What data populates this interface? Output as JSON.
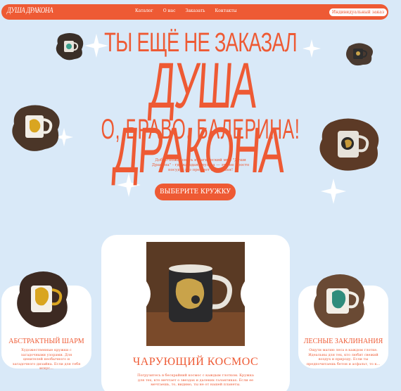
{
  "nav": {
    "logo": "ДУША ДРАКОНА",
    "links": [
      "Каталог",
      "О нас",
      "Заказать",
      "Контакты"
    ],
    "cta": "Индивидуальный заказ"
  },
  "hero": {
    "line1": "ТЫ ЕЩЁ НЕ ЗАКАЗАЛ",
    "line2": "ДУША ДРАКОНА",
    "line3": "О, БРАВО, БАЛЕРИНА!",
    "description": "Добро пожаловать в магический мир \"Души Дракона\" - где каждая кружка — это не просто посуда, это предмет обожания!",
    "button": "ВЫБЕРИТЕ КРУЖКУ"
  },
  "cards": [
    {
      "title": "АБСТРАКТНЫЙ ШАРМ",
      "text": "Художественные кружки с загадочными узорами. Для ценителей необычного и загадочного дизайна. Если для тебя искус..."
    },
    {
      "title": "ЧАРУЮЩИЙ КОСМОС",
      "text": "Погрузитесь в бескрайний космос с каждым глотком. Кружка для тех, кто мечтает о звездах и далеких галактиках. Если ее мечтаешь, то, видимо, ты не от нашей планеты."
    },
    {
      "title": "ЛЕСНЫЕ ЗАКЛИНАНИЯ",
      "text": "Ощути магию леса в каждом глотке. Идеальны для тех, кто любит свежий воздух и природу. Если ты предпочитаешь бетон и асфальт, то к..."
    }
  ],
  "colors": {
    "accent": "#ee5a34",
    "background": "#d9e9f8",
    "card": "#ffffff"
  }
}
